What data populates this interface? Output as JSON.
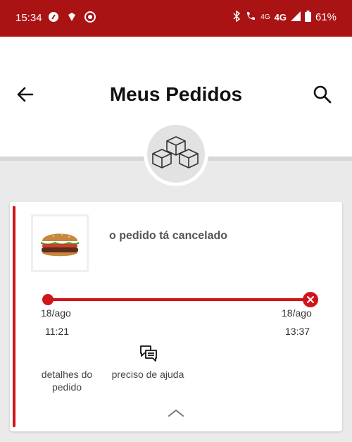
{
  "status_bar": {
    "time": "15:34",
    "network": "4G",
    "network_small": "4G",
    "battery": "61%"
  },
  "header": {
    "title": "Meus Pedidos"
  },
  "order": {
    "status_text": "o pedido tá cancelado",
    "timeline": {
      "start_date": "18/ago",
      "start_time": "11:21",
      "end_date": "18/ago",
      "end_time": "13:37"
    },
    "actions": {
      "details_label": "detalhes do pedido",
      "help_label": "preciso de ajuda"
    }
  },
  "icons": {
    "back": "arrow-left-icon",
    "search": "search-icon",
    "orders_badge": "boxes-icon",
    "help": "chat-icon",
    "cancel": "close-icon",
    "collapse": "chevron-up-icon"
  },
  "colors": {
    "status_bar": "#aa1313",
    "accent": "#d0141c",
    "background": "#eaeaea"
  }
}
